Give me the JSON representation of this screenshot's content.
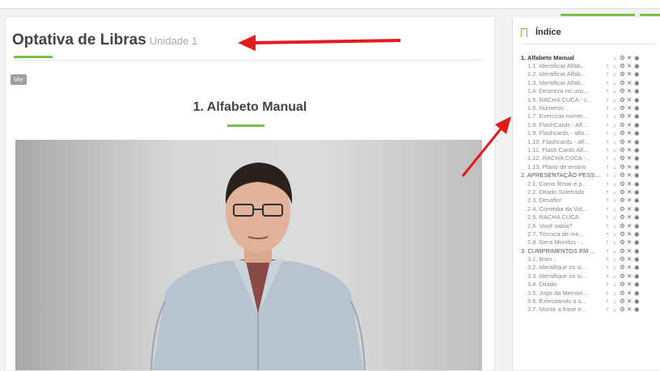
{
  "course": {
    "title": "Optativa de Libras",
    "unit": "Unidade 1",
    "ver_label": "Ver"
  },
  "section": {
    "title": "1. Alfabeto Manual"
  },
  "index": {
    "heading": "Índice",
    "action_glyphs": [
      "✚",
      "➜",
      "⊕",
      "✖",
      "⊙"
    ],
    "items": [
      {
        "label": "1. Alfabeto Manual",
        "level": "top",
        "bold": true
      },
      {
        "label": "1.1. Identificar Alfab...",
        "level": "sub"
      },
      {
        "label": "1.2. Identificar Alfab...",
        "level": "sub"
      },
      {
        "label": "1.3. Identificar Alfab...",
        "level": "sub"
      },
      {
        "label": "1.4. Destreza no uso...",
        "level": "sub"
      },
      {
        "label": "1.5. RACHA CUCA - c...",
        "level": "sub"
      },
      {
        "label": "1.6. Números",
        "level": "sub"
      },
      {
        "label": "1.7. Exercício numer...",
        "level": "sub"
      },
      {
        "label": "1.8. FlashCards - Alf...",
        "level": "sub"
      },
      {
        "label": "1.9. Flashcards - alfa...",
        "level": "sub"
      },
      {
        "label": "1.10. Flashcards - alf...",
        "level": "sub"
      },
      {
        "label": "1.11. Flash Cards Alf...",
        "level": "sub"
      },
      {
        "label": "1.12. RACHA CUCA -...",
        "level": "sub"
      },
      {
        "label": "1.13. Plano de ensino",
        "level": "sub"
      },
      {
        "label": "2. APRESENTAÇÃO PESS...",
        "level": "top"
      },
      {
        "label": "2.1. Como filmar e p...",
        "level": "sub"
      },
      {
        "label": "2.2. Ditado Soletrado",
        "level": "sub"
      },
      {
        "label": "2.3. Desafio!",
        "level": "sub"
      },
      {
        "label": "2.4. Comédia da Vid...",
        "level": "sub"
      },
      {
        "label": "2.5. RACHA CUCA",
        "level": "sub"
      },
      {
        "label": "2.6. Você sabia?",
        "level": "sub"
      },
      {
        "label": "2.7. Técnica de me...",
        "level": "sub"
      },
      {
        "label": "2.8. Gera Mundos -...",
        "level": "sub"
      },
      {
        "label": "3. CUMPRIMENTOS EM ...",
        "level": "top"
      },
      {
        "label": "3.1. Bom...",
        "level": "sub"
      },
      {
        "label": "3.2. Identifique os si...",
        "level": "sub"
      },
      {
        "label": "3.3. Identifique os si...",
        "level": "sub"
      },
      {
        "label": "3.4. Ditado",
        "level": "sub"
      },
      {
        "label": "3.5. Jogo da Memóri...",
        "level": "sub"
      },
      {
        "label": "3.6. Exercitando a s...",
        "level": "sub"
      },
      {
        "label": "3.7. Monte a frase e...",
        "level": "sub"
      }
    ]
  },
  "colors": {
    "accent": "#7bc04a",
    "arrow": "#e31b1b"
  }
}
